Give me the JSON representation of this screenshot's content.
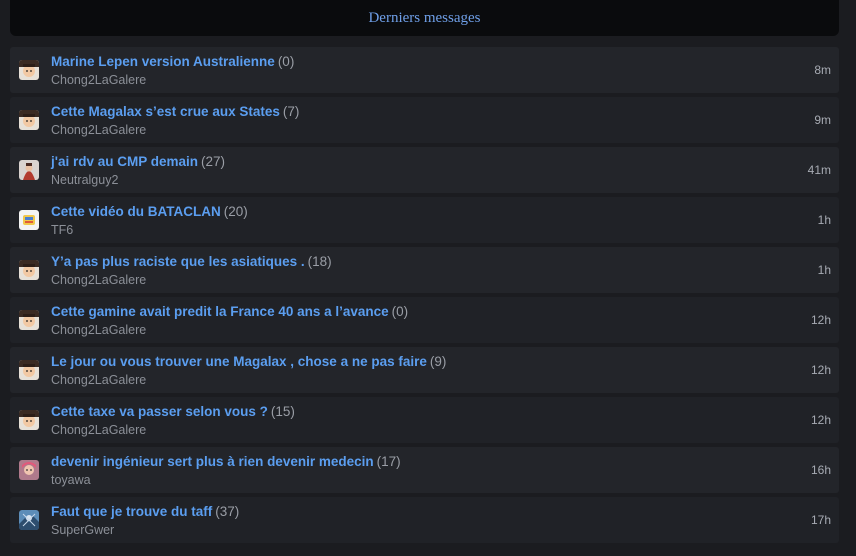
{
  "header": {
    "title": "Derniers messages"
  },
  "topics": [
    {
      "title": "Marine Lepen version Australienne",
      "count": "(0)",
      "author": "Chong2LaGalere",
      "time": "8m",
      "avatar": "chong-avatar-icon"
    },
    {
      "title": "Cette Magalax s’est crue aux States",
      "count": "(7)",
      "author": "Chong2LaGalere",
      "time": "9m",
      "avatar": "chong-avatar-icon"
    },
    {
      "title": "j'ai rdv au CMP demain",
      "count": "(27)",
      "author": "Neutralguy2",
      "time": "41m",
      "avatar": "neutralguy-avatar-icon"
    },
    {
      "title": "Cette vidéo du BATACLAN",
      "count": "(20)",
      "author": "TF6",
      "time": "1h",
      "avatar": "tf6-avatar-icon"
    },
    {
      "title": "Y’a pas plus raciste que les asiatiques .",
      "count": "(18)",
      "author": "Chong2LaGalere",
      "time": "1h",
      "avatar": "chong-avatar-icon"
    },
    {
      "title": "Cette gamine avait predit la France 40 ans a l’avance",
      "count": "(0)",
      "author": "Chong2LaGalere",
      "time": "12h",
      "avatar": "chong-avatar-icon"
    },
    {
      "title": "Le jour ou vous trouver une Magalax , chose a ne pas faire",
      "count": "(9)",
      "author": "Chong2LaGalere",
      "time": "12h",
      "avatar": "chong-avatar-icon"
    },
    {
      "title": "Cette taxe va passer selon vous ?",
      "count": "(15)",
      "author": "Chong2LaGalere",
      "time": "12h",
      "avatar": "chong-avatar-icon"
    },
    {
      "title": "devenir ingénieur sert plus à rien devenir medecin",
      "count": "(17)",
      "author": "toyawa",
      "time": "16h",
      "avatar": "toyawa-avatar-icon"
    },
    {
      "title": "Faut que je trouve du taff",
      "count": "(37)",
      "author": "SuperGwer",
      "time": "17h",
      "avatar": "supergwer-avatar-icon"
    }
  ]
}
